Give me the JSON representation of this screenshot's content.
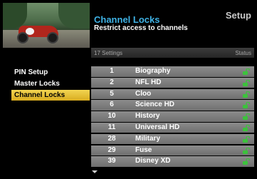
{
  "header": {
    "title": "Channel Locks",
    "subtitle": "Restrict access to channels",
    "section": "Setup"
  },
  "bar": {
    "settings_count": "17 Settings",
    "status_label": "Status"
  },
  "menu": {
    "items": [
      {
        "label": "PIN Setup"
      },
      {
        "label": "Master Locks"
      },
      {
        "label": "Channel Locks"
      }
    ],
    "selected": "Channel Locks"
  },
  "channels": [
    {
      "num": "1",
      "name": "Biography",
      "status": "unlocked"
    },
    {
      "num": "2",
      "name": "NFL HD",
      "status": "unlocked"
    },
    {
      "num": "5",
      "name": "Cloo",
      "status": "unlocked"
    },
    {
      "num": "6",
      "name": "Science HD",
      "status": "unlocked"
    },
    {
      "num": "10",
      "name": "History",
      "status": "unlocked"
    },
    {
      "num": "11",
      "name": "Universal HD",
      "status": "unlocked"
    },
    {
      "num": "28",
      "name": "Military",
      "status": "unlocked"
    },
    {
      "num": "29",
      "name": "Fuse",
      "status": "unlocked"
    },
    {
      "num": "39",
      "name": "Disney XD",
      "status": "unlocked"
    }
  ],
  "colors": {
    "title": "#3fb3e6",
    "selected_menu": "#e6bf2f",
    "row_bg": "#7e7e7e",
    "lock_icon": "#3cc23c"
  },
  "icons": {
    "status": "unlocked-padlock-icon",
    "scroll": "scroll-down-arrow-icon"
  }
}
